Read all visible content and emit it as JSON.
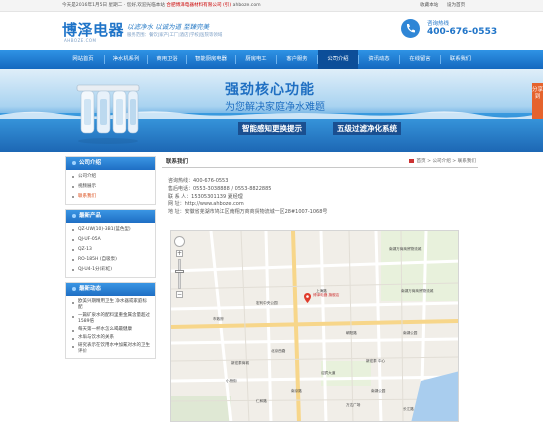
{
  "topbar": {
    "welcome": "今天是2016年1月5日 星期二 · 您好,欢迎光临本站",
    "company": "合肥博泽电器材料有限公司 (引)",
    "site": "ahboze.com",
    "links": [
      "收藏本站",
      "设为首页"
    ]
  },
  "header": {
    "brand": "博泽电器",
    "domain": "AHBOZE.COM",
    "slogan": "以滤净水 以诚为道 至臻完美",
    "services": "服务范围：餐饮|家产|工厂|酒店|学校|医院等领域",
    "hotline_label": "咨询热线",
    "hotline_number": "400-676-0553"
  },
  "nav": {
    "items": [
      "网站首页",
      "净水机系列",
      "商用卫浴",
      "智能厨房电器",
      "厨房电工",
      "客户服务",
      "公司介绍",
      "资讯动态",
      "在线留言",
      "联系我们"
    ],
    "active": "公司介绍"
  },
  "banner": {
    "headline": "强劲核心功能",
    "subline": "为您解决家庭净水难题",
    "badge1": "智能感知更换提示",
    "badge2": "五级过滤净化系统"
  },
  "share": "分享到",
  "sidebar": {
    "company_title": "公司介绍",
    "company_items": [
      "公司介绍",
      "视频展示",
      "联系我们"
    ],
    "company_active": "联系我们",
    "products_title": "最新产品",
    "product_items": [
      "QZ-UW(10)-3B1(蓝色型)",
      "QJ-UF-05A",
      "QZ-13",
      "RO-185H (自吸泵)",
      "QJ-U4-1分(彩虹)"
    ],
    "news_title": "最新动态",
    "news_items": [
      "欧美兴期精用卫生 净水器或家庭标配",
      "一篇矿泉水的配料里重金属含量超过1589倍",
      "每天第一杯水怎么喝最健康",
      "水垢与饮水的关系",
      "研究表示在饮用水中加氟对水的卫生评价"
    ]
  },
  "main": {
    "title": "联系我们",
    "breadcrumb": [
      "首页",
      "公司介绍",
      "联系我们"
    ],
    "contact": {
      "hotline": "咨询热线：400-676-0553",
      "aftersales": "售后电话：0553-3038888 / 0553-8822885",
      "person": "联 系 人：15305301139 夏经理",
      "website": "网    址：http://www.ahboze.com",
      "address": "地    址：安徽省芜湖市鸠江区南翔万商商贸物流城一区28#1007-1068号"
    }
  },
  "map": {
    "labels": [
      "南湖万商商贸物流城",
      "上海路",
      "南湖万商商贸物流城",
      "宏利中央公园",
      "市政府",
      "朝阳路",
      "南湖公园",
      "北京西路",
      "新宏泰商城",
      "新宏泰 中心",
      "迎宾大道",
      "小桥街",
      "南京路",
      "南湖公园",
      "仁和路",
      "万达广场",
      "长江路"
    ],
    "poi": "博泽电器\n旗舰店",
    "pin_color": "#e03b2b"
  },
  "colors": {
    "brand": "#1f74c8",
    "nav_active": "#0c4e99",
    "accent_link": "#d9440f",
    "share": "#e5632d"
  }
}
